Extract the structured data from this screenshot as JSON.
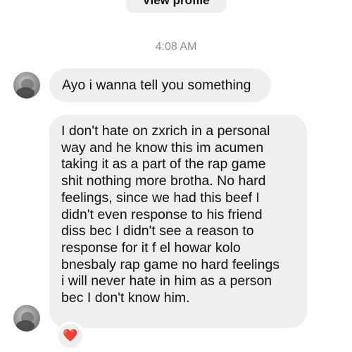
{
  "header": {
    "view_profile_label": "View profile"
  },
  "thread": {
    "timestamp": "4:08 AM",
    "messages": [
      {
        "text": "Ayo i wanna tell you something"
      },
      {
        "text": "I don't hate on zxrich in a personal\nway and he know this im acumen\ntaking it as a part of the rap game\nshit nothing more brotha. No hard\nfeelings, since we had this beef I\ndidn't even response to his friend\ndiss bec I didn't see a reason to\nresponse for it f el howar kolo\nbnesbaly rap game no hard feelings\ni will never hate in him as a person\nbec I don't know him."
      }
    ],
    "reaction": "❤️"
  },
  "colors": {
    "bubble": "#efefef",
    "timestamp": "#8e8e8e",
    "heart": "#e0202c"
  }
}
